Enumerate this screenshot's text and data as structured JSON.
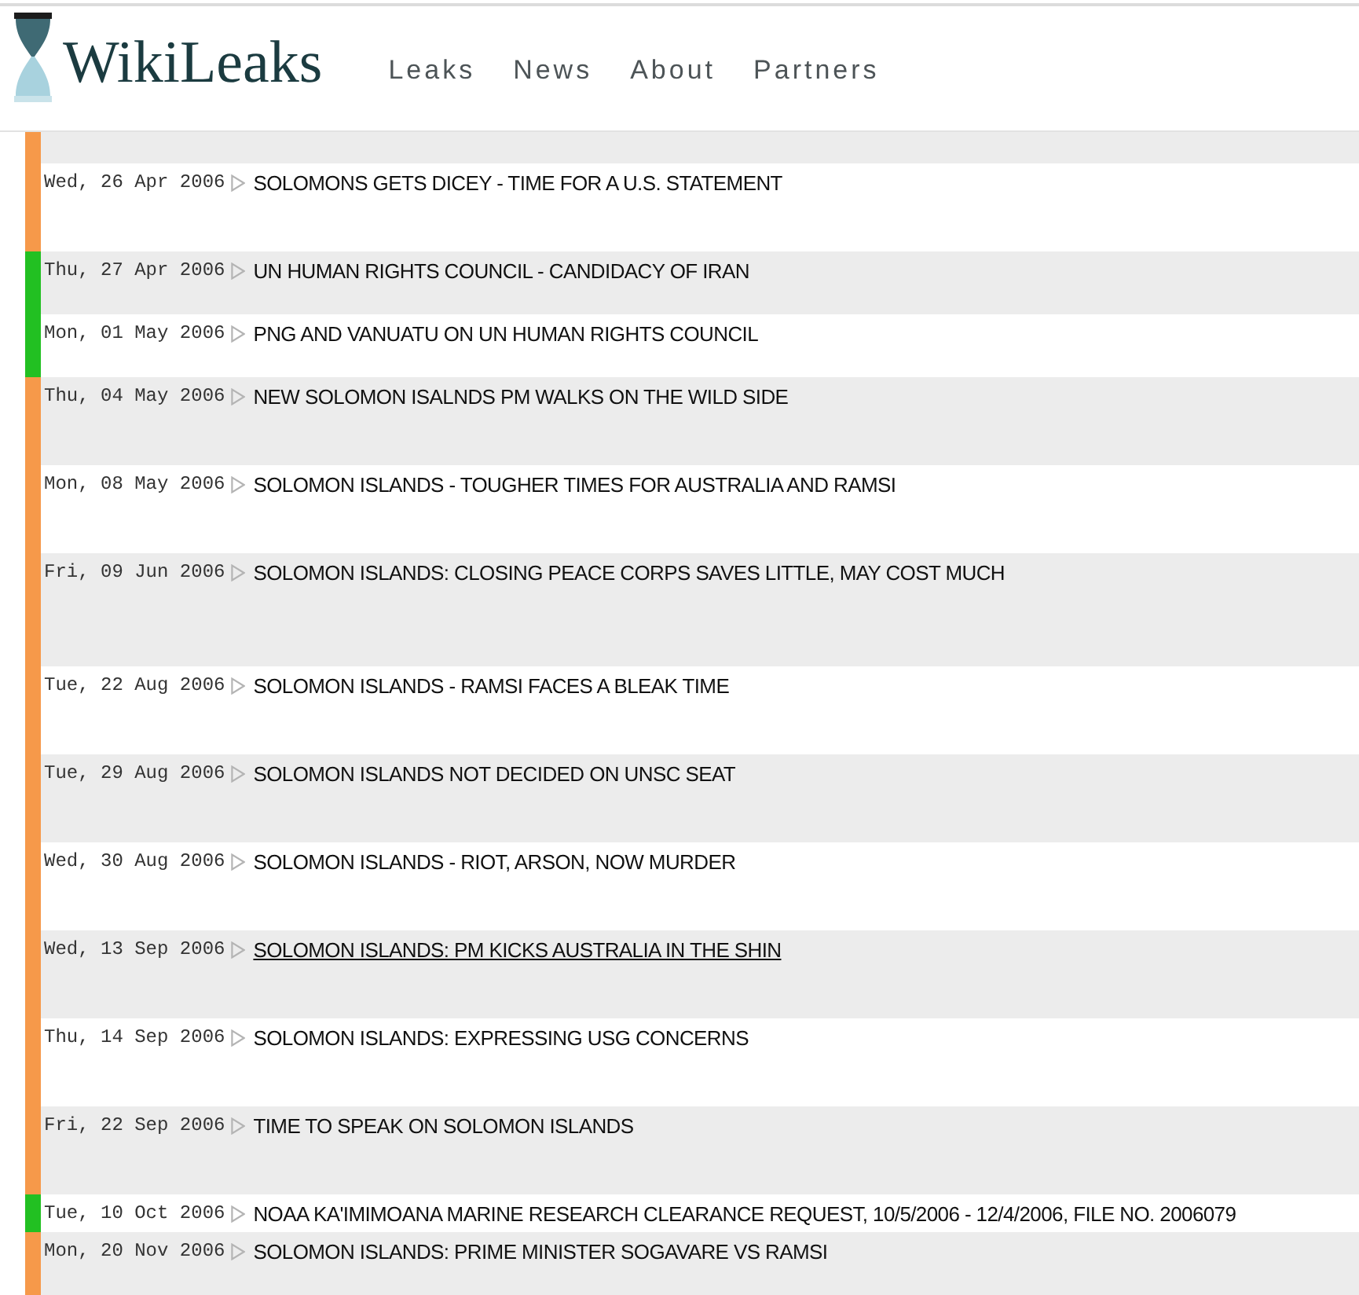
{
  "header": {
    "logo_text": "WikiLeaks",
    "nav": [
      "Leaks",
      "News",
      "About",
      "Partners"
    ]
  },
  "rows": [
    {
      "date": "Wed, 26 Apr 2006",
      "title": "SOLOMONS GETS DICEY - TIME FOR A U.S. STATEMENT",
      "color": "#f6994a",
      "hovered": false
    },
    {
      "date": "Thu, 27 Apr 2006",
      "title": "UN HUMAN RIGHTS COUNCIL - CANDIDACY OF IRAN",
      "color": "#22c022",
      "hovered": false
    },
    {
      "date": "Mon, 01 May 2006",
      "title": "PNG AND VANUATU ON UN HUMAN RIGHTS COUNCIL",
      "color": "#22c022",
      "hovered": false
    },
    {
      "date": "Thu, 04 May 2006",
      "title": "NEW SOLOMON ISALNDS PM WALKS ON THE WILD SIDE",
      "color": "#f6994a",
      "hovered": false
    },
    {
      "date": "Mon, 08 May 2006",
      "title": "SOLOMON ISLANDS - TOUGHER TIMES FOR AUSTRALIA AND RAMSI",
      "color": "#f6994a",
      "hovered": false
    },
    {
      "date": "Fri, 09 Jun 2006",
      "title": "SOLOMON ISLANDS: CLOSING PEACE CORPS SAVES LITTLE, MAY COST MUCH",
      "color": "#f6994a",
      "hovered": false
    },
    {
      "date": "Tue, 22 Aug 2006",
      "title": "SOLOMON ISLANDS - RAMSI FACES A BLEAK TIME",
      "color": "#f6994a",
      "hovered": false
    },
    {
      "date": "Tue, 29 Aug 2006",
      "title": "SOLOMON ISLANDS NOT DECIDED ON UNSC SEAT",
      "color": "#f6994a",
      "hovered": false
    },
    {
      "date": "Wed, 30 Aug 2006",
      "title": "SOLOMON ISLANDS - RIOT, ARSON, NOW MURDER",
      "color": "#f6994a",
      "hovered": false
    },
    {
      "date": "Wed, 13 Sep 2006",
      "title": "SOLOMON ISLANDS: PM KICKS AUSTRALIA IN THE SHIN",
      "color": "#f6994a",
      "hovered": true
    },
    {
      "date": "Thu, 14 Sep 2006",
      "title": "SOLOMON ISLANDS: EXPRESSING USG CONCERNS",
      "color": "#f6994a",
      "hovered": false
    },
    {
      "date": "Fri, 22 Sep 2006",
      "title": "TIME TO SPEAK ON SOLOMON ISLANDS",
      "color": "#f6994a",
      "hovered": false
    },
    {
      "date": "Tue, 10 Oct 2006",
      "title": "NOAA KA'IMIMOANA MARINE RESEARCH CLEARANCE REQUEST, 10/5/2006 - 12/4/2006, FILE NO. 2006079",
      "color": "#22c022",
      "hovered": false
    },
    {
      "date": "Mon, 20 Nov 2006",
      "title": "SOLOMON ISLANDS: PRIME MINISTER SOGAVARE VS RAMSI",
      "color": "#f6994a",
      "hovered": false
    }
  ]
}
